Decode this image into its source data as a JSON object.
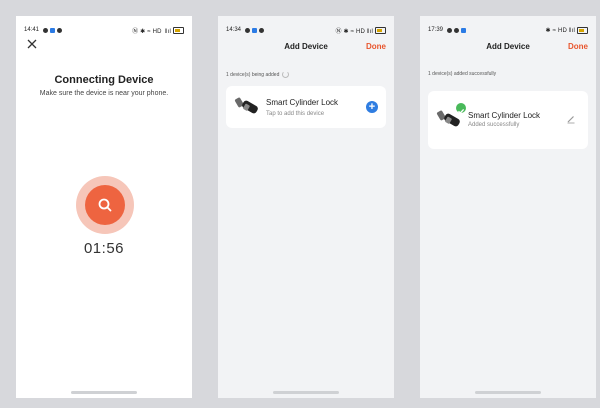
{
  "colors": {
    "accent": "#ee6440",
    "done": "#e8552d",
    "add_button": "#2f7de1",
    "success": "#49b95a"
  },
  "screen1": {
    "status_time": "14:41",
    "status_right": "Ⓝ ✱ ≈ HD  ‖ıl",
    "title": "Connecting Device",
    "subtitle": "Make sure the device is near your phone.",
    "timer": "01:56",
    "icons": [
      "close-icon",
      "search-icon"
    ]
  },
  "screen2": {
    "status_time": "14:34",
    "status_right": "Ⓝ ✱ ≈ HD ‖ıl",
    "header_title": "Add Device",
    "done_label": "Done",
    "section_label": "1 device(s) being added",
    "device_name": "Smart Cylinder Lock",
    "device_sub": "Tap to add this device",
    "add_symbol": "+"
  },
  "screen3": {
    "status_time": "17:39",
    "status_right": "✱ ≈ HD ‖ıl",
    "header_title": "Add Device",
    "done_label": "Done",
    "section_label": "1 device(s) added successfully",
    "device_name": "Smart Cylinder Lock",
    "device_sub": "Added successfully"
  }
}
